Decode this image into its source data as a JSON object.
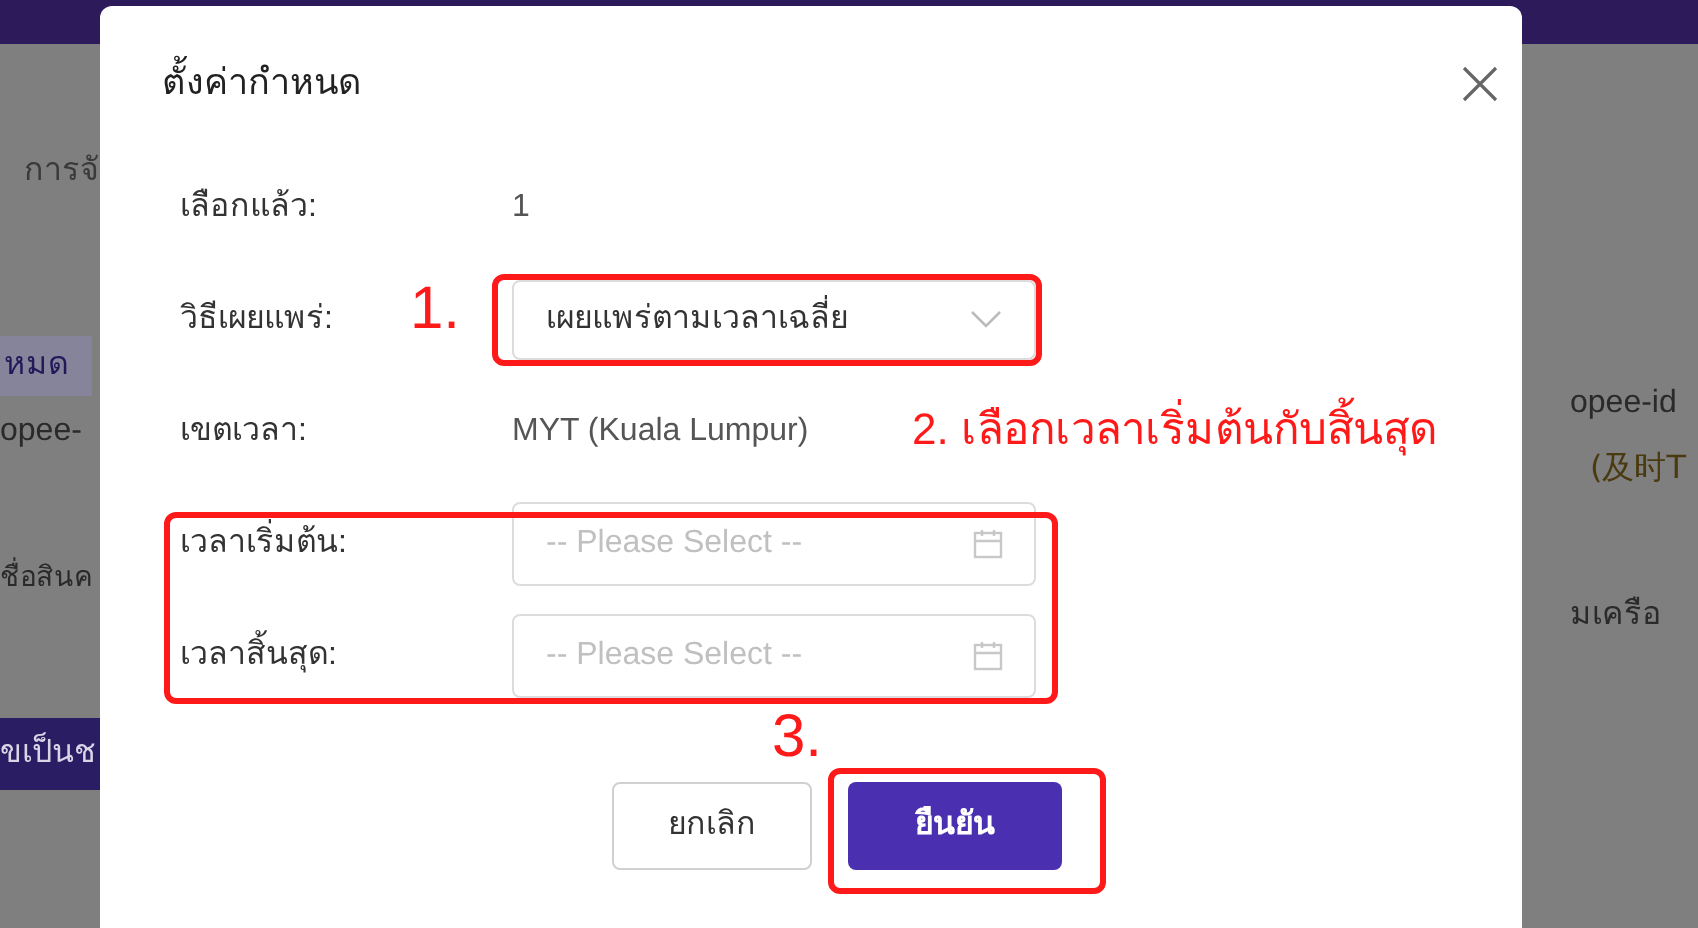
{
  "background": {
    "breadcrumb": "การจั",
    "filter_tag": "หมด",
    "left_cell": "opee-",
    "left_column": "ชื่อสินค",
    "left_button": "ขเป็นช",
    "right_cell": "opee-id",
    "right_note": "(及时T",
    "right_column": "มเครือ"
  },
  "dialog": {
    "title": "ตั้งค่ากำหนด",
    "fields": [
      {
        "kind": "text",
        "label": "เลือกแล้ว:",
        "value": "1"
      },
      {
        "kind": "select",
        "label": "วิธีเผยแพร่:",
        "value": "เผยแพร่ตามเวลาเฉลี่ย"
      },
      {
        "kind": "text",
        "label": "เขตเวลา:",
        "value": "MYT (Kuala Lumpur)"
      },
      {
        "kind": "date",
        "label": "เวลาเริ่มต้น:",
        "placeholder": "-- Please Select --"
      },
      {
        "kind": "date",
        "label": "เวลาสิ้นสุด:",
        "placeholder": "-- Please Select --"
      }
    ],
    "buttons": [
      {
        "label": "ยกเลิก",
        "primary": false
      },
      {
        "label": "ยืนยัน",
        "primary": true
      }
    ]
  },
  "annotations": [
    {
      "kind": "number",
      "text": "1."
    },
    {
      "kind": "note",
      "text": "2. เลือกเวลาเริ่มต้นกับสิ้นสุด"
    },
    {
      "kind": "number",
      "text": "3."
    }
  ]
}
